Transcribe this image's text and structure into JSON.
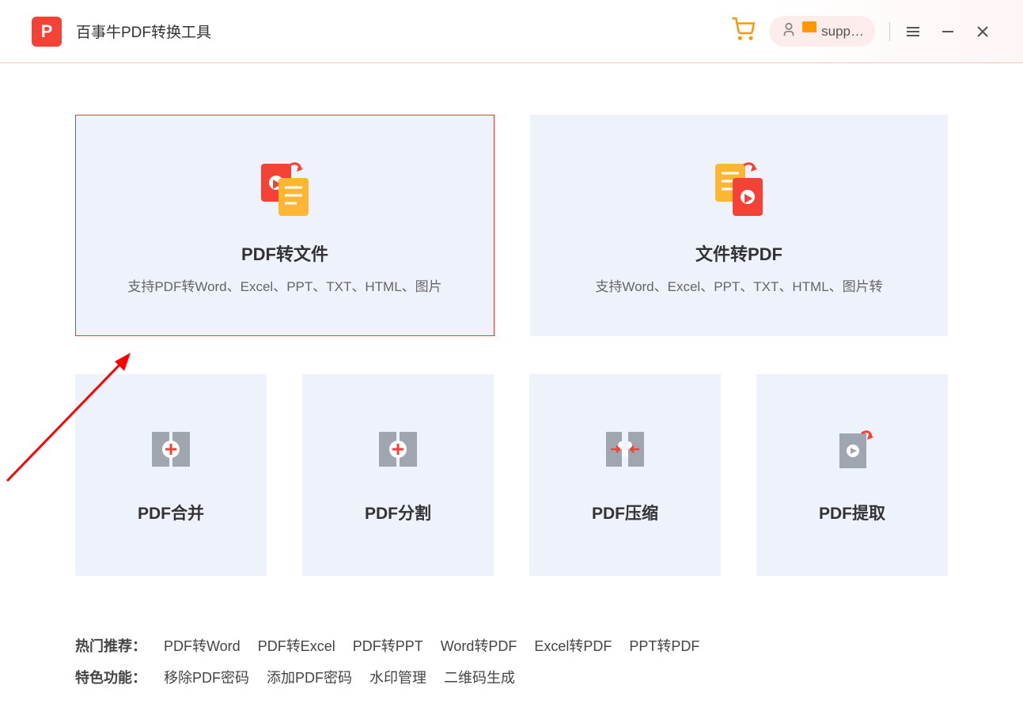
{
  "header": {
    "app_title": "百事牛PDF转换工具",
    "logo_letter": "P",
    "user_name": "supp…"
  },
  "main": {
    "big_cards": [
      {
        "title": "PDF转文件",
        "desc": "支持PDF转Word、Excel、PPT、TXT、HTML、图片",
        "selected": true
      },
      {
        "title": "文件转PDF",
        "desc": "支持Word、Excel、PPT、TXT、HTML、图片转",
        "selected": false
      }
    ],
    "small_cards": [
      {
        "title": "PDF合并"
      },
      {
        "title": "PDF分割"
      },
      {
        "title": "PDF压缩"
      },
      {
        "title": "PDF提取"
      }
    ]
  },
  "footer": {
    "hot_label": "热门推荐：",
    "hot_links": [
      "PDF转Word",
      "PDF转Excel",
      "PDF转PPT",
      "Word转PDF",
      "Excel转PDF",
      "PPT转PDF"
    ],
    "feature_label": "特色功能：",
    "feature_links": [
      "移除PDF密码",
      "添加PDF密码",
      "水印管理",
      "二维码生成"
    ]
  }
}
